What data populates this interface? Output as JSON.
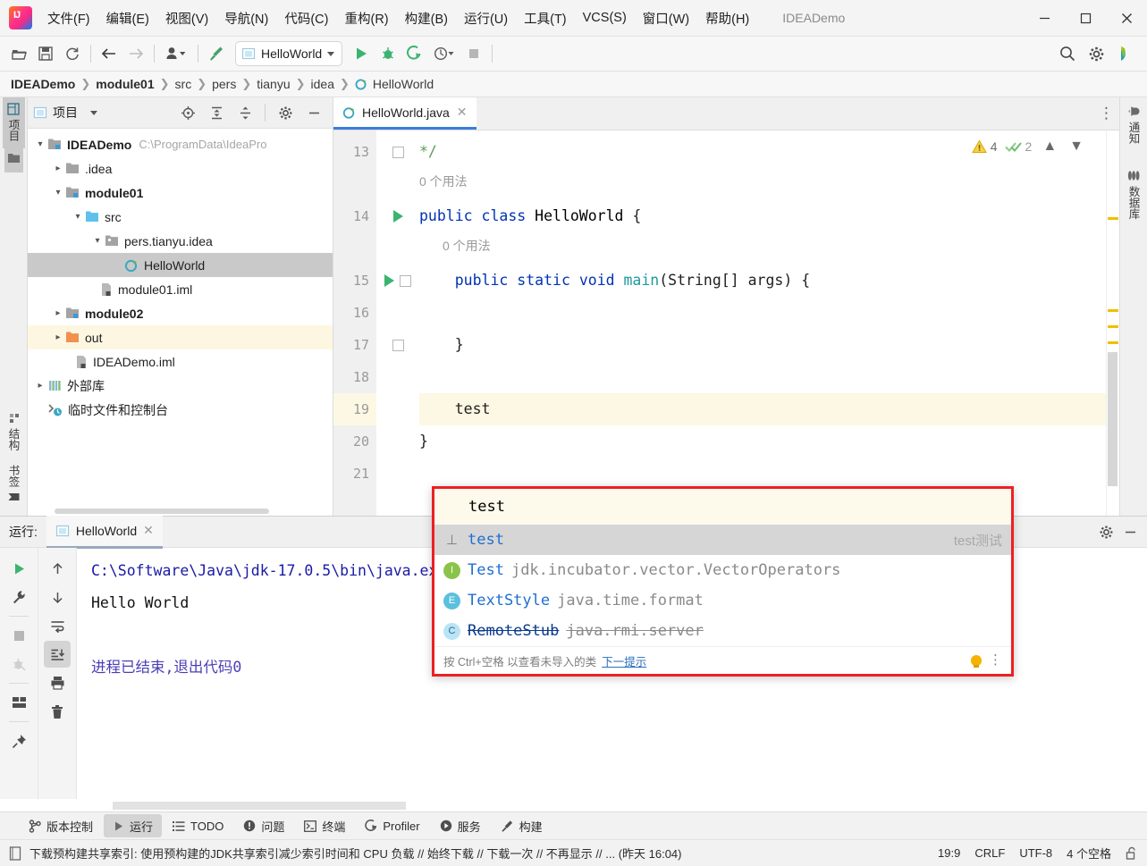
{
  "window": {
    "app_title": "IDEADemo",
    "minimize": "─",
    "maximize": "☐",
    "close": "✕"
  },
  "menu": [
    {
      "label": "文件(F)"
    },
    {
      "label": "编辑(E)"
    },
    {
      "label": "视图(V)"
    },
    {
      "label": "导航(N)"
    },
    {
      "label": "代码(C)"
    },
    {
      "label": "重构(R)"
    },
    {
      "label": "构建(B)"
    },
    {
      "label": "运行(U)"
    },
    {
      "label": "工具(T)"
    },
    {
      "label": "VCS(S)"
    },
    {
      "label": "窗口(W)"
    },
    {
      "label": "帮助(H)"
    }
  ],
  "toolbar": {
    "open_icon": "folder-open-icon",
    "save_icon": "save-icon",
    "sync_icon": "refresh-icon",
    "back_icon": "arrow-left-icon",
    "forward_icon": "arrow-right-icon",
    "user_icon": "user-icon",
    "build_icon": "hammer-icon",
    "run_config": "HelloWorld",
    "run_icon": "run-icon",
    "debug_icon": "debug-icon",
    "run_coverage_icon": "run-with-coverage-icon",
    "profiler_icon": "profiler-icon",
    "stop_icon": "stop-icon",
    "search_icon": "search-icon",
    "settings_icon": "gear-icon",
    "ai_icon": "ai-assistant-icon"
  },
  "breadcrumb": [
    "IDEADemo",
    "module01",
    "src",
    "pers",
    "tianyu",
    "idea",
    "HelloWorld"
  ],
  "left_strip": [
    {
      "label": "项目",
      "icon": "project-icon",
      "active": true
    },
    {
      "label": "",
      "icon": "folder-icon",
      "active": true
    },
    {
      "label": "结构",
      "icon": "structure-icon",
      "active": false
    },
    {
      "label": "书签",
      "icon": "bookmark-icon",
      "active": false
    }
  ],
  "right_strip": [
    {
      "label": "通知",
      "icon": "bell-icon"
    },
    {
      "label": "数据库",
      "icon": "database-icon"
    }
  ],
  "project_panel": {
    "title": "项目",
    "dropdown_icon": "chevron-down-icon",
    "icons": [
      "locate-icon",
      "expand-all-icon",
      "collapse-all-icon",
      "gear-icon",
      "minimize-icon"
    ],
    "tree": [
      {
        "label": "IDEADemo",
        "path": "C:\\ProgramData\\IdeaPro",
        "depth": 0,
        "arrow": "down",
        "icon": "module-icon",
        "bold": true,
        "state": "none"
      },
      {
        "label": ".idea",
        "path": "",
        "depth": 1,
        "arrow": "right",
        "icon": "folder-icon",
        "bold": false,
        "state": "none"
      },
      {
        "label": "module01",
        "path": "",
        "depth": 1,
        "arrow": "down",
        "icon": "module-icon",
        "bold": true,
        "state": "none"
      },
      {
        "label": "src",
        "path": "",
        "depth": 2,
        "arrow": "down",
        "icon": "source-folder-icon",
        "bold": false,
        "state": "none"
      },
      {
        "label": "pers.tianyu.idea",
        "path": "",
        "depth": 3,
        "arrow": "down",
        "icon": "package-icon",
        "bold": false,
        "state": "none"
      },
      {
        "label": "HelloWorld",
        "path": "",
        "depth": 4,
        "arrow": "none",
        "icon": "java-class-icon",
        "bold": false,
        "state": "selected"
      },
      {
        "label": "module01.iml",
        "path": "",
        "depth": 3,
        "arrow": "none",
        "icon": "iml-file-icon",
        "bold": false,
        "state": "none"
      },
      {
        "label": "module02",
        "path": "",
        "depth": 1,
        "arrow": "right",
        "icon": "module-icon",
        "bold": true,
        "state": "none"
      },
      {
        "label": "out",
        "path": "",
        "depth": 1,
        "arrow": "right",
        "icon": "excluded-folder-icon",
        "bold": false,
        "state": "highlight"
      },
      {
        "label": "IDEADemo.iml",
        "path": "",
        "depth": 2,
        "arrow": "none",
        "icon": "iml-file-icon",
        "bold": false,
        "state": "none"
      },
      {
        "label": "外部库",
        "path": "",
        "depth": 0,
        "arrow": "right",
        "icon": "library-icon",
        "bold": false,
        "state": "none"
      },
      {
        "label": "临时文件和控制台",
        "path": "",
        "depth": 0,
        "arrow": "none",
        "icon": "scratches-icon",
        "bold": false,
        "state": "none"
      }
    ]
  },
  "editor": {
    "tab": {
      "label": "HelloWorld.java",
      "icon": "java-class-icon",
      "close_icon": "close-icon"
    },
    "more_icon": "more-vertical-icon",
    "inspections": {
      "warning_icon": "warning-triangle-icon",
      "warning_count": "4",
      "ok_icon": "double-check-icon",
      "ok_count": "2",
      "prev_icon": "chevron-up-icon",
      "next_icon": "chevron-down-icon"
    },
    "lines": [
      {
        "num": "13",
        "kind": "code",
        "fold": "end",
        "run": false,
        "highlight": false,
        "segments": [
          {
            "t": "  ",
            "c": "plain"
          },
          {
            "t": "*/",
            "c": "comment"
          }
        ]
      },
      {
        "num": "",
        "kind": "hint",
        "fold": "none",
        "run": false,
        "highlight": false,
        "segments": [
          {
            "t": "0 个用法",
            "c": "hint"
          }
        ]
      },
      {
        "num": "14",
        "kind": "code",
        "fold": "none",
        "run": true,
        "highlight": false,
        "segments": [
          {
            "t": "public class ",
            "c": "keyword"
          },
          {
            "t": "HelloWorld",
            "c": "class"
          },
          {
            "t": " {",
            "c": "plain"
          }
        ]
      },
      {
        "num": "",
        "kind": "hint2",
        "fold": "none",
        "run": false,
        "highlight": false,
        "segments": [
          {
            "t": "0 个用法",
            "c": "hint"
          }
        ]
      },
      {
        "num": "15",
        "kind": "code",
        "fold": "start",
        "run": true,
        "highlight": false,
        "segments": [
          {
            "t": "    ",
            "c": "plain"
          },
          {
            "t": "public static void ",
            "c": "keyword"
          },
          {
            "t": "main",
            "c": "type"
          },
          {
            "t": "(String[] args) {",
            "c": "plain"
          }
        ]
      },
      {
        "num": "16",
        "kind": "code",
        "fold": "none",
        "run": false,
        "highlight": false,
        "segments": []
      },
      {
        "num": "17",
        "kind": "code",
        "fold": "end",
        "run": false,
        "highlight": false,
        "segments": [
          {
            "t": "    }",
            "c": "plain"
          }
        ]
      },
      {
        "num": "18",
        "kind": "code",
        "fold": "none",
        "run": false,
        "highlight": false,
        "segments": []
      },
      {
        "num": "19",
        "kind": "code",
        "fold": "none",
        "run": false,
        "highlight": true,
        "segments": [
          {
            "t": "    test",
            "c": "plain"
          }
        ]
      },
      {
        "num": "20",
        "kind": "code",
        "fold": "none",
        "run": false,
        "highlight": false,
        "segments": [
          {
            "t": "}",
            "c": "plain"
          }
        ]
      },
      {
        "num": "21",
        "kind": "code",
        "fold": "none",
        "run": false,
        "highlight": false,
        "segments": []
      }
    ]
  },
  "autocomplete": {
    "typed_text": "test",
    "items": [
      {
        "badge": "v",
        "badge_label": "variable-icon",
        "name": "test",
        "package": "",
        "right": "test测试",
        "selected": true,
        "deprecated": false
      },
      {
        "badge": "I",
        "badge_label": "interface-icon",
        "name": "Test",
        "package": "jdk.incubator.vector.VectorOperators",
        "right": "",
        "selected": false,
        "deprecated": false
      },
      {
        "badge": "E",
        "badge_label": "enum-icon",
        "name": "TextStyle",
        "package": "java.time.format",
        "right": "",
        "selected": false,
        "deprecated": false
      },
      {
        "badge": "C",
        "badge_label": "class-icon",
        "name": "RemoteStub",
        "package": "java.rmi.server",
        "right": "",
        "selected": false,
        "deprecated": true
      }
    ],
    "footer_text": "按 Ctrl+空格 以查看未导入的类",
    "footer_link": "下一提示",
    "bulb_icon": "lightbulb-icon",
    "more_icon": "more-vertical-icon",
    "border_color": "#ec2024"
  },
  "console": {
    "title": "运行:",
    "tab": {
      "label": "HelloWorld",
      "icon": "run-config-icon",
      "close_icon": "close-icon"
    },
    "settings_icon": "gear-icon",
    "minimize_icon": "minimize-icon",
    "tools_left": [
      "rerun-icon",
      "wrench-icon",
      "stop-icon",
      "debug-dim-icon",
      "layout-icon",
      "pin-icon"
    ],
    "tools_right": [
      "arrow-up-icon",
      "arrow-down-icon",
      "soft-wrap-icon",
      "scroll-to-end-icon",
      "print-icon",
      "trash-icon"
    ],
    "lines": [
      {
        "text": "C:\\Software\\Java\\jdk-17.0.5\\bin\\java.exe \"-javaagent:C:\\Software\\JetBrains\\IntelliJ IDE",
        "color": "blue"
      },
      {
        "text": "Hello World",
        "color": "black"
      },
      {
        "text": "",
        "color": "black"
      },
      {
        "text": "进程已结束,退出代码0",
        "color": "purple"
      }
    ]
  },
  "status_buttons": [
    {
      "label": "版本控制",
      "icon": "branch-icon",
      "active": false
    },
    {
      "label": "运行",
      "icon": "run-icon",
      "active": true
    },
    {
      "label": "TODO",
      "icon": "list-icon",
      "active": false
    },
    {
      "label": "问题",
      "icon": "problems-icon",
      "active": false
    },
    {
      "label": "终端",
      "icon": "terminal-icon",
      "active": false
    },
    {
      "label": "Profiler",
      "icon": "profiler-icon",
      "active": false
    },
    {
      "label": "服务",
      "icon": "services-icon",
      "active": false
    },
    {
      "label": "构建",
      "icon": "hammer-icon",
      "active": false
    }
  ],
  "status_bar": {
    "message_icon": "document-icon",
    "message": "下载预构建共享索引: 使用预构建的JDK共享索引减少索引时间和 CPU 负载 // 始终下载 // 下载一次 // 不再显示 // ... (昨天 16:04)",
    "caret": "19:9",
    "line_sep": "CRLF",
    "encoding": "UTF-8",
    "indent": "4 个空格",
    "lock_icon": "unlocked-icon"
  }
}
